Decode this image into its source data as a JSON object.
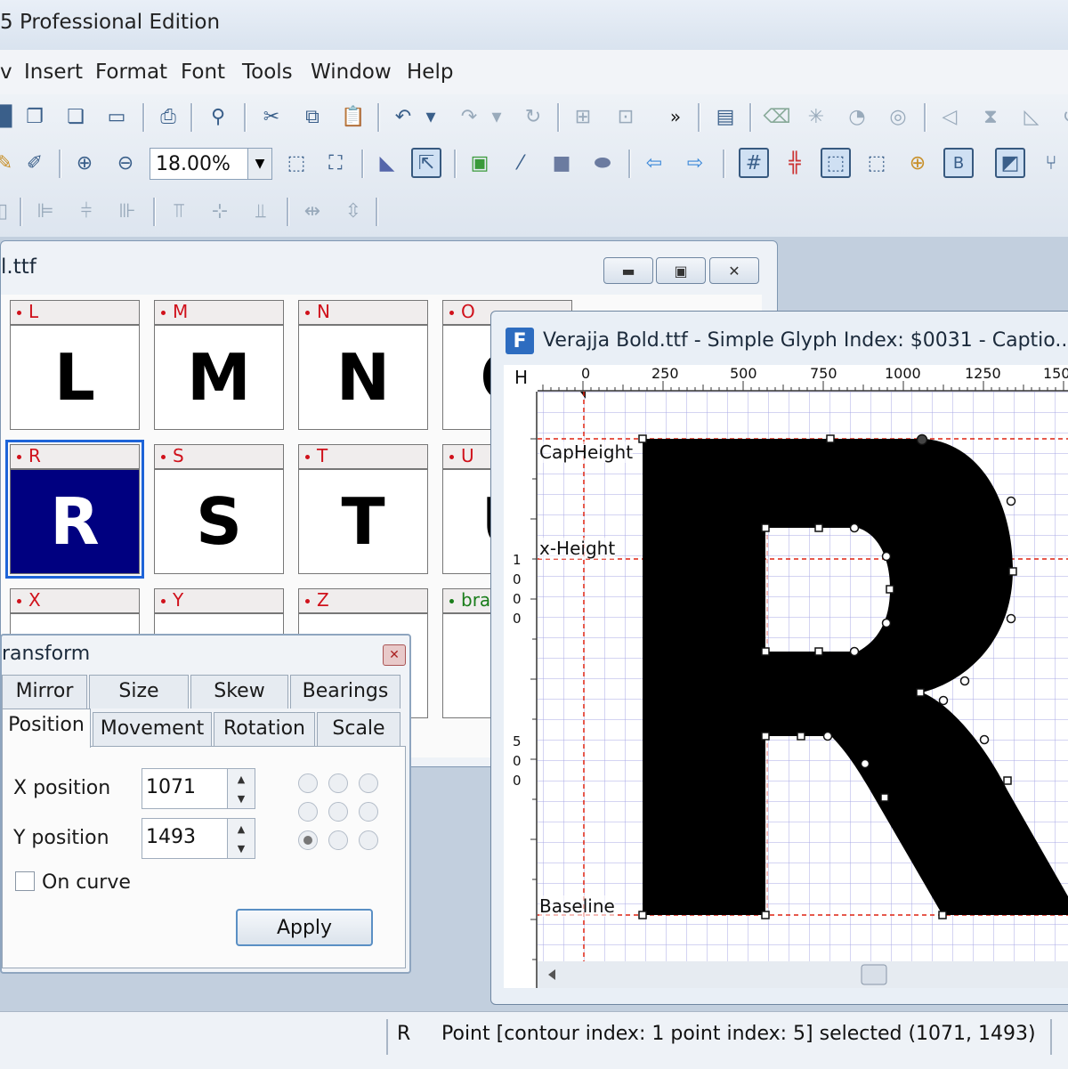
{
  "app": {
    "title": "5 Professional Edition"
  },
  "menu": [
    "v",
    "Insert",
    "Format",
    "Font",
    "Tools",
    "Window",
    "Help"
  ],
  "toolbar": {
    "zoom_value": "18.00%"
  },
  "font_window": {
    "title": "l.ttf",
    "cells": [
      {
        "name": "L",
        "glyph": "L"
      },
      {
        "name": "M",
        "glyph": "M"
      },
      {
        "name": "N",
        "glyph": "N"
      },
      {
        "name": "O",
        "glyph": "O"
      },
      {
        "name": "R",
        "glyph": "R"
      },
      {
        "name": "S",
        "glyph": "S"
      },
      {
        "name": "T",
        "glyph": "T"
      },
      {
        "name": "U",
        "glyph": "U"
      },
      {
        "name": "X",
        "glyph": ""
      },
      {
        "name": "Y",
        "glyph": ""
      },
      {
        "name": "Z",
        "glyph": ""
      },
      {
        "name": "bra",
        "glyph": "["
      }
    ]
  },
  "transform_dialog": {
    "title": "ransform",
    "tabs_row1": [
      "Mirror",
      "Size",
      "Skew",
      "Bearings"
    ],
    "tabs_row2": [
      "Position",
      "Movement",
      "Rotation",
      "Scale"
    ],
    "active_tab": "Position",
    "x_label": "X position",
    "x_value": "1071",
    "y_label": "Y position",
    "y_value": "1493",
    "oncurve_label": "On curve",
    "apply_label": "Apply"
  },
  "glyph_window": {
    "title": "Verajja Bold.ttf - Simple Glyph Index: $0031 - Captio...",
    "h_label": "H",
    "ruler_ticks": [
      "0",
      "250",
      "500",
      "750",
      "1000",
      "1250",
      "150"
    ],
    "vruler_1000": [
      "1",
      "0",
      "0",
      "0"
    ],
    "vruler_500": [
      "5",
      "0",
      "0"
    ],
    "guides": [
      "CapHeight",
      "x-Height",
      "Baseline"
    ]
  },
  "status": {
    "glyph": "R",
    "message": "Point [contour index: 1 point index: 5] selected (1071, 1493)"
  }
}
